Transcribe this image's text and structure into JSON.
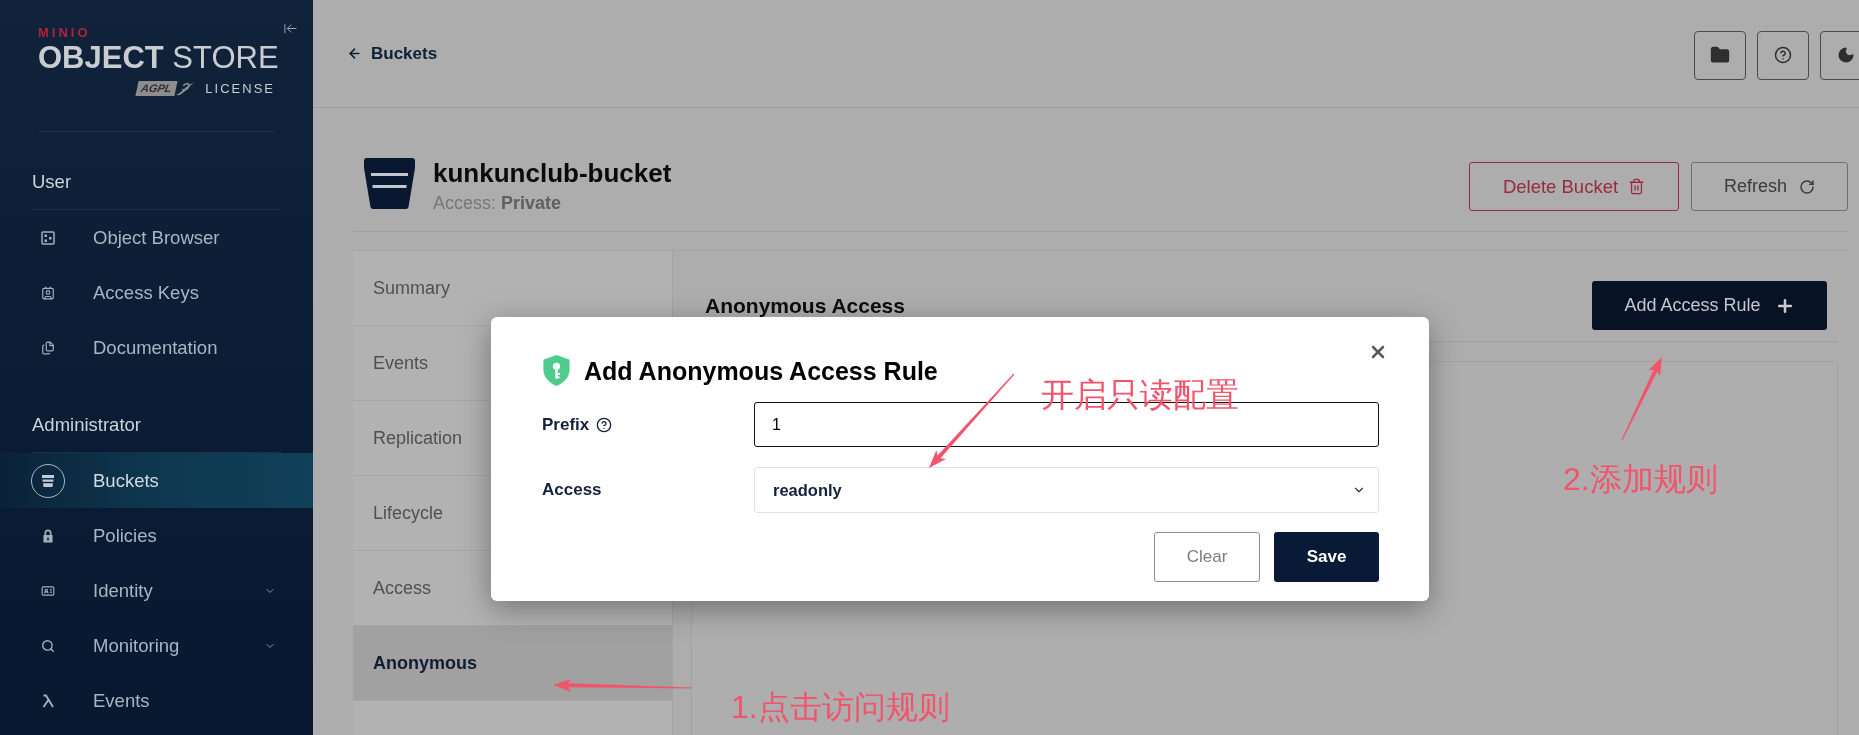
{
  "sidebar": {
    "brand": "MINIO",
    "product": "**OBJECT** STORE",
    "license_badge": "AGPL",
    "license": "LICENSE",
    "sections": [
      {
        "title": "User",
        "items": [
          {
            "label": "Object Browser",
            "selected": false,
            "expandable": false
          },
          {
            "label": "Access Keys",
            "selected": false,
            "expandable": false
          },
          {
            "label": "Documentation",
            "selected": false,
            "expandable": false
          }
        ]
      },
      {
        "title": "Administrator",
        "items": [
          {
            "label": "Buckets",
            "selected": true,
            "expandable": false
          },
          {
            "label": "Policies",
            "selected": false,
            "expandable": false
          },
          {
            "label": "Identity",
            "selected": false,
            "expandable": true
          },
          {
            "label": "Monitoring",
            "selected": false,
            "expandable": true
          },
          {
            "label": "Events",
            "selected": false,
            "expandable": false
          }
        ]
      }
    ]
  },
  "header": {
    "back_link": "Buckets"
  },
  "bucket": {
    "name": "kunkunclub-bucket",
    "access": "Access: **Private**",
    "buttons": [
      {
        "label": "Delete Bucket",
        "kind": "danger"
      },
      {
        "label": "Refresh",
        "kind": "refresh"
      }
    ]
  },
  "tabs": [
    {
      "label": "Summary",
      "selected": false
    },
    {
      "label": "Events",
      "selected": false
    },
    {
      "label": "Replication",
      "selected": false
    },
    {
      "label": "Lifecycle",
      "selected": false
    },
    {
      "label": "Access",
      "selected": false
    },
    {
      "label": "Anonymous",
      "selected": true
    }
  ],
  "panel": {
    "title": "Anonymous Access",
    "add_button": "Add Access Rule"
  },
  "dialog": {
    "title": "Add Anonymous Access Rule",
    "fields": [
      {
        "kind": "text",
        "label": "Prefix",
        "help": true,
        "focused": true,
        "value": "1"
      },
      {
        "kind": "select",
        "label": "Access",
        "help": false,
        "focused": false,
        "value": "readonly"
      }
    ],
    "buttons": [
      {
        "label": "Clear",
        "kind": "secondary"
      },
      {
        "label": "Save",
        "kind": "primary"
      }
    ]
  },
  "annotations": [
    {
      "text": "开启只读配置"
    },
    {
      "text": "2.添加规则"
    },
    {
      "text": "1.点击访问规则"
    }
  ]
}
